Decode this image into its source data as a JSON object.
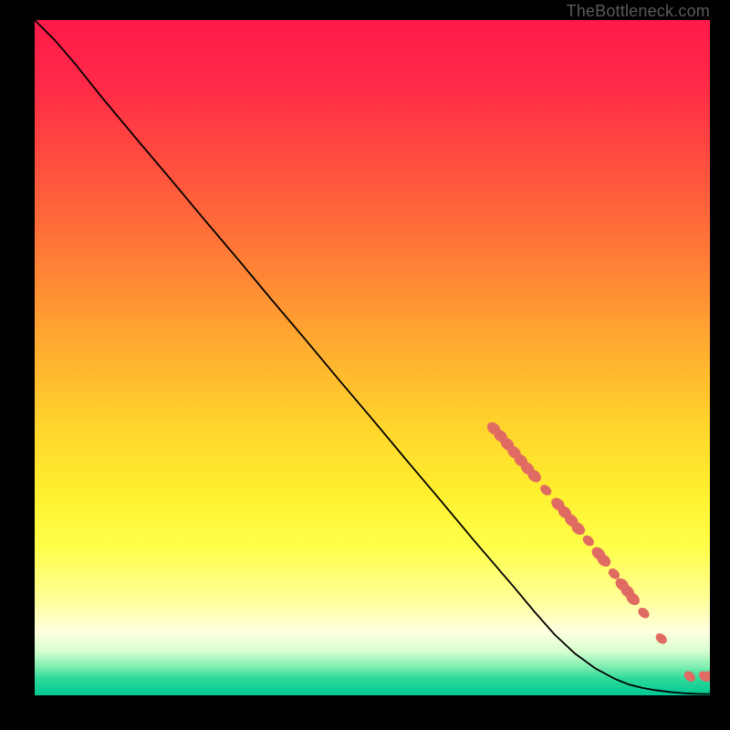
{
  "watermark": "TheBottleneck.com",
  "gradient": {
    "stops": [
      {
        "offset": 0.0,
        "color": "#ff1a4a"
      },
      {
        "offset": 0.1,
        "color": "#ff2b47"
      },
      {
        "offset": 0.2,
        "color": "#ff4a3f"
      },
      {
        "offset": 0.3,
        "color": "#ff6b39"
      },
      {
        "offset": 0.4,
        "color": "#ff8e34"
      },
      {
        "offset": 0.5,
        "color": "#ffb22f"
      },
      {
        "offset": 0.6,
        "color": "#ffd42c"
      },
      {
        "offset": 0.7,
        "color": "#fff02f"
      },
      {
        "offset": 0.78,
        "color": "#ffff4a"
      },
      {
        "offset": 0.86,
        "color": "#ffff9a"
      },
      {
        "offset": 0.905,
        "color": "#ffffe0"
      },
      {
        "offset": 0.935,
        "color": "#d6ffcf"
      },
      {
        "offset": 0.955,
        "color": "#8af0b4"
      },
      {
        "offset": 0.975,
        "color": "#2fd99a"
      },
      {
        "offset": 1.0,
        "color": "#00c893"
      }
    ]
  },
  "chart_data": {
    "type": "line",
    "title": "",
    "xlabel": "",
    "ylabel": "",
    "xlim": [
      0,
      100
    ],
    "ylim": [
      0,
      100
    ],
    "series": [
      {
        "name": "bottleneck-curve",
        "x": [
          0,
          3,
          6,
          10,
          15,
          20,
          25,
          30,
          35,
          40,
          45,
          50,
          55,
          60,
          65,
          68,
          71,
          74,
          77,
          80,
          83,
          86,
          88,
          90,
          92,
          94,
          96,
          97,
          98,
          99,
          100
        ],
        "y": [
          100,
          97,
          93.5,
          88.5,
          82.5,
          76.6,
          70.6,
          64.7,
          58.7,
          52.8,
          46.8,
          40.9,
          34.9,
          29.0,
          23.0,
          19.5,
          16.0,
          12.4,
          9.0,
          6.2,
          4.0,
          2.4,
          1.6,
          1.1,
          0.75,
          0.5,
          0.32,
          0.26,
          0.22,
          0.2,
          0.2
        ]
      }
    ],
    "markers": {
      "name": "highlighted-points",
      "color": "#e06b62",
      "points": [
        {
          "x": 68.0,
          "y": 39.5,
          "r": 6
        },
        {
          "x": 69.0,
          "y": 38.4,
          "r": 6
        },
        {
          "x": 70.0,
          "y": 37.2,
          "r": 6
        },
        {
          "x": 71.0,
          "y": 36.0,
          "r": 6
        },
        {
          "x": 72.0,
          "y": 34.8,
          "r": 6
        },
        {
          "x": 73.0,
          "y": 33.6,
          "r": 6
        },
        {
          "x": 74.0,
          "y": 32.5,
          "r": 6
        },
        {
          "x": 75.7,
          "y": 30.4,
          "r": 5
        },
        {
          "x": 77.5,
          "y": 28.3,
          "r": 6
        },
        {
          "x": 78.5,
          "y": 27.1,
          "r": 6
        },
        {
          "x": 79.5,
          "y": 25.9,
          "r": 6
        },
        {
          "x": 80.5,
          "y": 24.7,
          "r": 6
        },
        {
          "x": 82.0,
          "y": 22.9,
          "r": 5
        },
        {
          "x": 83.5,
          "y": 21.0,
          "r": 6
        },
        {
          "x": 84.3,
          "y": 20.0,
          "r": 6
        },
        {
          "x": 85.8,
          "y": 18.0,
          "r": 5
        },
        {
          "x": 87.0,
          "y": 16.4,
          "r": 6
        },
        {
          "x": 87.8,
          "y": 15.4,
          "r": 6
        },
        {
          "x": 88.6,
          "y": 14.3,
          "r": 6
        },
        {
          "x": 90.2,
          "y": 12.2,
          "r": 5
        },
        {
          "x": 92.8,
          "y": 8.4,
          "r": 5
        },
        {
          "x": 97.0,
          "y": 2.8,
          "r": 5
        },
        {
          "x": 99.2,
          "y": 2.8,
          "r": 5
        },
        {
          "x": 100.0,
          "y": 2.8,
          "r": 5
        }
      ]
    }
  }
}
